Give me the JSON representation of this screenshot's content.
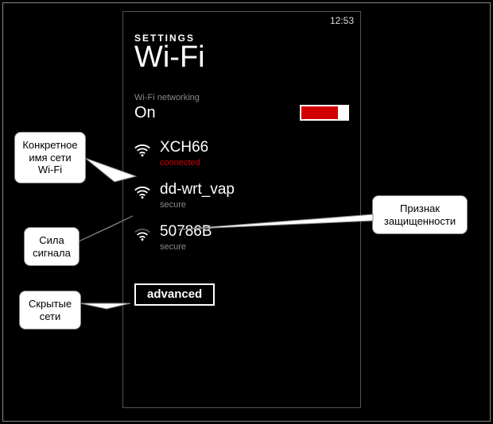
{
  "statusbar": {
    "time": "12:53"
  },
  "header": {
    "section": "SETTINGS",
    "title": "Wi-Fi"
  },
  "networking": {
    "label": "Wi-Fi networking",
    "state": "On"
  },
  "networks": [
    {
      "name": "XCH66",
      "sub": "connected",
      "sub_red": true,
      "strength": 3
    },
    {
      "name": "dd-wrt_vap",
      "sub": "secure",
      "sub_red": false,
      "strength": 3
    },
    {
      "name": "50786B",
      "sub": "secure",
      "sub_red": false,
      "strength": 2
    }
  ],
  "advanced_label": "advanced",
  "callouts": {
    "ssid": "Конкретное имя сети Wi-Fi",
    "signal": "Сила сигнала",
    "hidden": "Скрытые сети",
    "secure": "Признак защищенности"
  }
}
